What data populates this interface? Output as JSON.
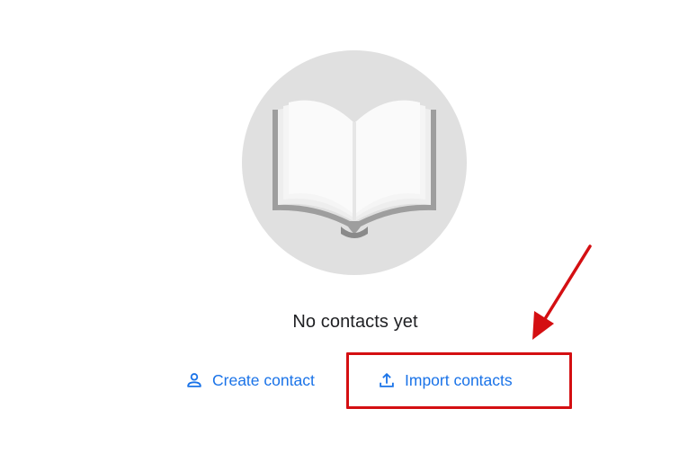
{
  "empty_state": {
    "illustration_icon": "open-book-icon",
    "message": "No contacts yet"
  },
  "actions": {
    "create": {
      "label": "Create contact",
      "icon": "person-icon"
    },
    "import": {
      "label": "Import contacts",
      "icon": "upload-icon"
    }
  },
  "annotation": {
    "color": "#d40f12",
    "highlights": "import"
  },
  "colors": {
    "accent": "#1a73e8",
    "text": "#202124",
    "illustration_bg": "#e0e0e0"
  }
}
